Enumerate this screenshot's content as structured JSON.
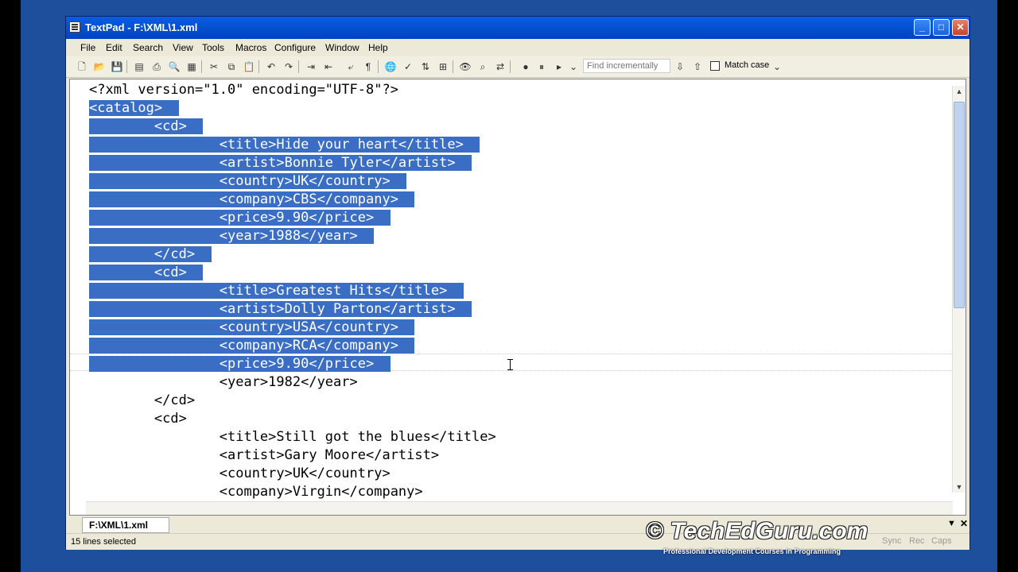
{
  "window": {
    "title": "TextPad - F:\\XML\\1.xml",
    "min": "_",
    "max": "□",
    "close": "✕"
  },
  "menu": [
    "File",
    "Edit",
    "Search",
    "View",
    "Tools",
    "Macros",
    "Configure",
    "Window",
    "Help"
  ],
  "toolbar": {
    "find_placeholder": "Find incrementally",
    "match_case": "Match case"
  },
  "editor": {
    "lines": [
      {
        "indent": "",
        "text": "<?xml version=\"1.0\" encoding=\"UTF-8\"?>",
        "selected": false
      },
      {
        "indent": "",
        "text": "<catalog>",
        "selected": true
      },
      {
        "indent": "        ",
        "text": "<cd>",
        "selected": true
      },
      {
        "indent": "                ",
        "text": "<title>Hide your heart</title>",
        "selected": true
      },
      {
        "indent": "                ",
        "text": "<artist>Bonnie Tyler</artist>",
        "selected": true
      },
      {
        "indent": "                ",
        "text": "<country>UK</country>",
        "selected": true
      },
      {
        "indent": "                ",
        "text": "<company>CBS</company>",
        "selected": true
      },
      {
        "indent": "                ",
        "text": "<price>9.90</price>",
        "selected": true
      },
      {
        "indent": "                ",
        "text": "<year>1988</year>",
        "selected": true
      },
      {
        "indent": "        ",
        "text": "</cd>",
        "selected": true
      },
      {
        "indent": "        ",
        "text": "<cd>",
        "selected": true
      },
      {
        "indent": "                ",
        "text": "<title>Greatest Hits</title>",
        "selected": true
      },
      {
        "indent": "                ",
        "text": "<artist>Dolly Parton</artist>",
        "selected": true
      },
      {
        "indent": "                ",
        "text": "<country>USA</country>",
        "selected": true
      },
      {
        "indent": "                ",
        "text": "<company>RCA</company>",
        "selected": true
      },
      {
        "indent": "                ",
        "text": "<price>9.90</price>",
        "selected": true
      },
      {
        "indent": "                ",
        "text": "<year>1982</year>",
        "selected": false
      },
      {
        "indent": "        ",
        "text": "</cd>",
        "selected": false
      },
      {
        "indent": "        ",
        "text": "<cd>",
        "selected": false
      },
      {
        "indent": "                ",
        "text": "<title>Still got the blues</title>",
        "selected": false
      },
      {
        "indent": "                ",
        "text": "<artist>Gary Moore</artist>",
        "selected": false
      },
      {
        "indent": "                ",
        "text": "<country>UK</country>",
        "selected": false
      },
      {
        "indent": "                ",
        "text": "<company>Virgin</company>",
        "selected": false
      }
    ]
  },
  "tabs": {
    "active": "F:\\XML\\1.xml",
    "close": "✕",
    "menu": "▼"
  },
  "status": {
    "text": "15 lines selected",
    "cells": [
      "Sync",
      "Rec",
      "Caps"
    ]
  },
  "watermark": {
    "text": "© TechEdGuru.com",
    "sub": "Professional Development Courses in Programming"
  },
  "colors": {
    "selection": "#3a6ec4",
    "titlebar": "#0553d4"
  }
}
